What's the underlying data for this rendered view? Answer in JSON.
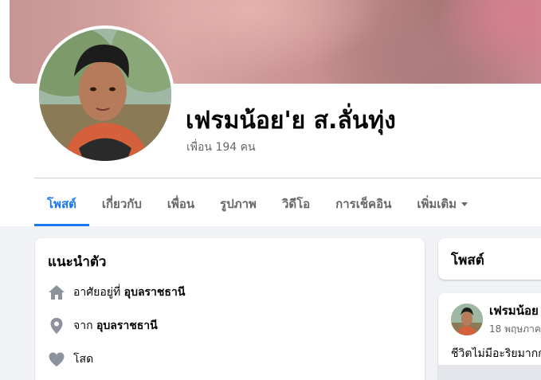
{
  "profile": {
    "name": "เฟรมน้อย'ย ส.ลั่นทุ่ง",
    "friends": "เพื่อน 194 คน"
  },
  "tabs": [
    {
      "label": "โพสต์",
      "active": true
    },
    {
      "label": "เกี่ยวกับ"
    },
    {
      "label": "เพื่อน"
    },
    {
      "label": "รูปภาพ"
    },
    {
      "label": "วิดีโอ"
    },
    {
      "label": "การเช็คอิน"
    },
    {
      "label": "เพิ่มเติม"
    }
  ],
  "intro": {
    "title": "แนะนำตัว",
    "rows": [
      {
        "icon": "home-icon",
        "prefix": "อาศัยอยู่ที่ ",
        "value": "อุบลราชธานี"
      },
      {
        "icon": "location-pin-icon",
        "prefix": "จาก ",
        "value": "อุบลราชธานี"
      },
      {
        "icon": "heart-icon",
        "prefix": "",
        "value": "โสด"
      }
    ]
  },
  "posts": {
    "title": "โพสต์",
    "first_post": {
      "author": "เฟรมน้อย",
      "date": "18 พฤษภาค",
      "text": "ชีวิตไม่มีอะริยมากก"
    }
  },
  "colors": {
    "accent": "#1877f2",
    "muted_text": "#65676b",
    "background": "#f0f2f5"
  }
}
